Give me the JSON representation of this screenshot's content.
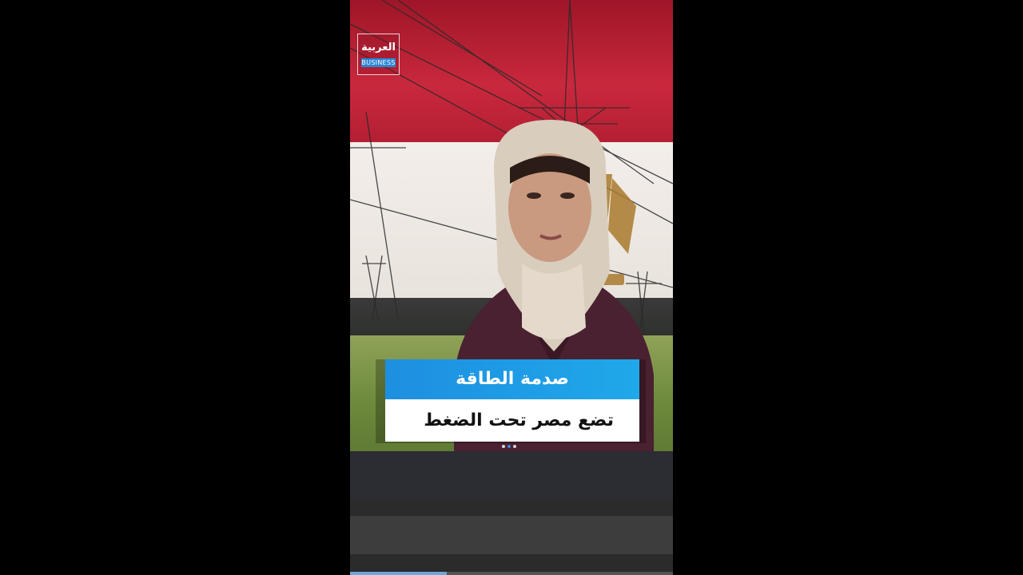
{
  "channel_logo": {
    "arabic": "العربية",
    "english": "BUSINESS"
  },
  "headline": {
    "title": "صدمة الطاقة",
    "subtitle": "تضع مصر تحت الضغط"
  },
  "pager": {
    "total": 3,
    "active": 2
  },
  "playback": {
    "progress_fraction": 0.3
  },
  "colors": {
    "flag_red": "#c9283d",
    "flag_white": "#f3eeea",
    "flag_black": "#2b2f2a",
    "headline_blue": "#1e8fe0",
    "progress": "#6ea7d8"
  }
}
